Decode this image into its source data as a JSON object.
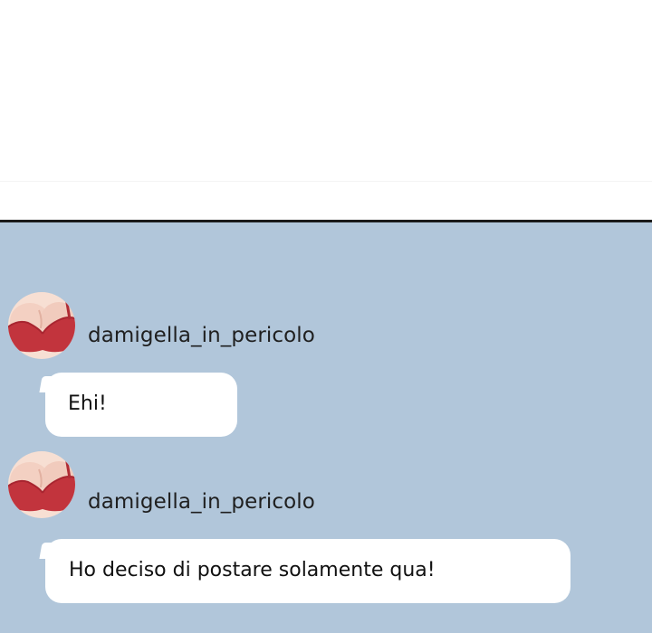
{
  "theme": {
    "chat_background": "#b1c6da",
    "bubble_background": "#ffffff",
    "divider_color": "#1a1a1a"
  },
  "messages": [
    {
      "username": "damigella_in_pericolo",
      "avatar_icon": "avatar-red-bra-icon",
      "text": "Ehi!"
    },
    {
      "username": "damigella_in_pericolo",
      "avatar_icon": "avatar-red-bra-icon",
      "text": "Ho deciso di postare solamente qua!"
    }
  ]
}
